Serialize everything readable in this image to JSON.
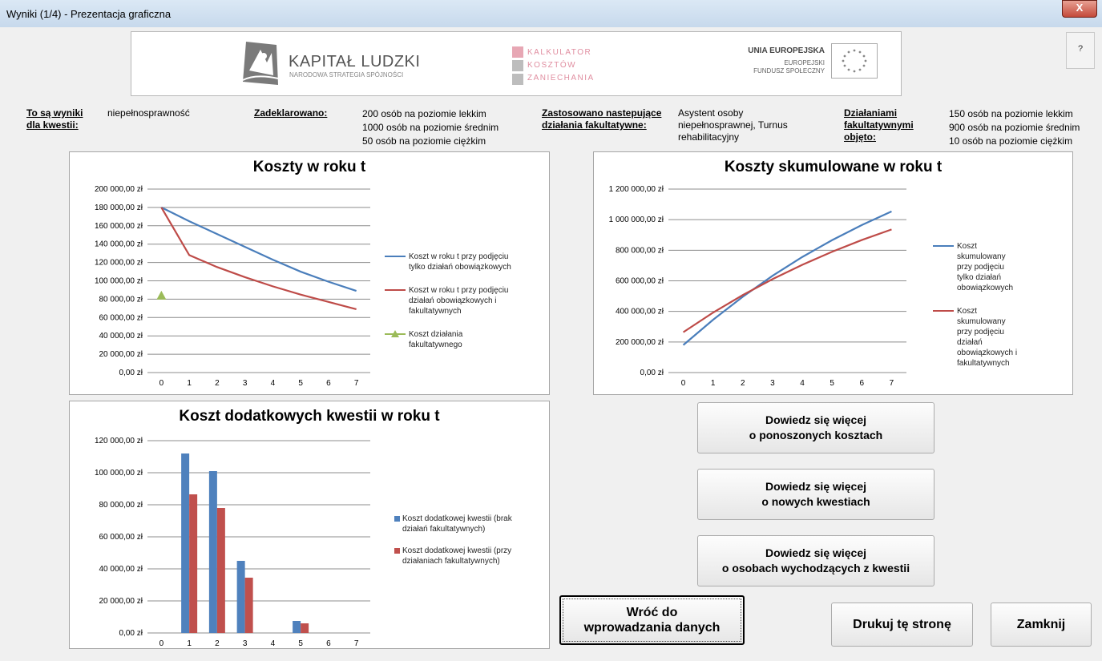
{
  "window": {
    "title": "Wyniki (1/4) - Prezentacja graficzna",
    "close_label": "X",
    "help_label": "?"
  },
  "banner": {
    "kl_title": "KAPITAŁ LUDZKI",
    "kl_subtitle": "NARODOWA STRATEGIA SPÓJNOŚCI",
    "kk_line1": "KALKULATOR",
    "kk_line2": "KOSZTÓW",
    "kk_line3": "ZANIECHANIA",
    "ue_title": "UNIA EUROPEJSKA",
    "ue_sub1": "EUROPEJSKI",
    "ue_sub2": "FUNDUSZ SPOŁECZNY"
  },
  "info": {
    "results_label": "To są wyniki dla kwestii:",
    "results_value": "niepełnosprawność",
    "declared_label": "Zadeklarowano:",
    "declared": [
      "200 osób na poziomie lekkim",
      "1000 osób na poziomie średnim",
      "50 osób na poziomie ciężkim"
    ],
    "applied_label": "Zastosowano nastepujące działania fakultatywne:",
    "applied_value": "Asystent osoby niepełnosprawnej, Turnus rehabilitacyjny",
    "covered_label": "Działaniami fakultatywnymi objęto:",
    "covered": [
      "150 osób na poziomie lekkim",
      "900 osób na poziomie średnim",
      "10 osób na poziomie ciężkim"
    ]
  },
  "buttons": {
    "costs": "Dowiedz się więcej\no ponoszonych kosztach",
    "new_issues": "Dowiedz się więcej\no nowych kwestiach",
    "leaving": "Dowiedz się więcej\no osobach wychodzących z kwestii",
    "back": "Wróć do\nwprowadzania danych",
    "print": "Drukuj tę stronę",
    "close": "Zamknij"
  },
  "chart_data": [
    {
      "type": "line",
      "title": "Koszty w roku t",
      "x": [
        0,
        1,
        2,
        3,
        4,
        5,
        6,
        7
      ],
      "ylim": [
        0,
        200000
      ],
      "yticks": [
        "200 000,00 zł",
        "180 000,00 zł",
        "160 000,00 zł",
        "140 000,00 zł",
        "120 000,00 zł",
        "100 000,00 zł",
        "80 000,00 zł",
        "60 000,00 zł",
        "40 000,00 zł",
        "20 000,00 zł",
        "0,00 zł"
      ],
      "series": [
        {
          "name": "Koszt w roku t przy podjęciu tylko działań obowiązkowych",
          "color": "#4a7ebb",
          "values": [
            180000,
            165000,
            151000,
            137000,
            123000,
            110000,
            99000,
            89000
          ]
        },
        {
          "name": "Koszt w roku t przy podjęciu działań obowiązkowych i fakultatywnych",
          "color": "#be4b48",
          "values": [
            180000,
            128000,
            115000,
            104000,
            94000,
            85000,
            77000,
            69000
          ]
        },
        {
          "name": "Koszt działania fakultatywnego",
          "color": "#9bbb59",
          "marker": "triangle",
          "values": [
            84000
          ]
        }
      ],
      "legend_lines": [
        [
          "Koszt w roku t przy podjęciu",
          "tylko działań obowiązkowych"
        ],
        [
          "Koszt w roku t przy podjęciu",
          "działań obowiązkowych i",
          "fakultatywnych"
        ],
        [
          "Koszt działania",
          "fakultatywnego"
        ]
      ]
    },
    {
      "type": "line",
      "title": "Koszty skumulowane w roku t",
      "x": [
        0,
        1,
        2,
        3,
        4,
        5,
        6,
        7
      ],
      "ylim": [
        0,
        1200000
      ],
      "yticks": [
        "1 200 000,00 zł",
        "1 000 000,00 zł",
        "800 000,00 zł",
        "600 000,00 zł",
        "400 000,00 zł",
        "200 000,00 zł",
        "0,00 zł"
      ],
      "series": [
        {
          "name": "Koszt skumulowany przy podjęciu tylko działań obowiązkowych",
          "color": "#4a7ebb",
          "values": [
            180000,
            345000,
            496000,
            633000,
            756000,
            866000,
            965000,
            1054000
          ]
        },
        {
          "name": "Koszt skumulowany przy podjęciu działań obowiązkowych i fakultatywnych",
          "color": "#be4b48",
          "values": [
            264000,
            392000,
            507000,
            611000,
            705000,
            790000,
            867000,
            936000
          ]
        }
      ],
      "legend_lines": [
        [
          "Koszt",
          "skumulowany",
          "przy podjęciu",
          "tylko działań",
          "obowiązkowych"
        ],
        [
          "Koszt",
          "skumulowany",
          "przy podjęciu",
          "działań",
          "obowiązkowych i",
          "fakultatywnych"
        ]
      ]
    },
    {
      "type": "bar",
      "title": "Koszt dodatkowych kwestii w roku t",
      "categories": [
        "0",
        "1",
        "2",
        "3",
        "4",
        "5",
        "6",
        "7"
      ],
      "ylim": [
        0,
        120000
      ],
      "yticks": [
        "120 000,00 zł",
        "100 000,00 zł",
        "80 000,00 zł",
        "60 000,00 zł",
        "40 000,00 zł",
        "20 000,00 zł",
        "0,00 zł"
      ],
      "series": [
        {
          "name": "Koszt dodatkowej kwestii (brak działań fakultatywnych)",
          "color": "#4f81bd",
          "values": [
            0,
            112000,
            101000,
            45000,
            0,
            7500,
            0,
            0
          ]
        },
        {
          "name": "Koszt dodatkowej kwestii (przy działaniach fakultatywnych)",
          "color": "#c0504d",
          "values": [
            0,
            86500,
            78000,
            34500,
            0,
            6000,
            0,
            0
          ]
        }
      ],
      "legend_lines": [
        [
          "Koszt dodatkowej kwestii (brak",
          "działań fakultatywnych)"
        ],
        [
          "Koszt dodatkowej kwestii (przy",
          "działaniach fakultatywnych)"
        ]
      ]
    }
  ]
}
